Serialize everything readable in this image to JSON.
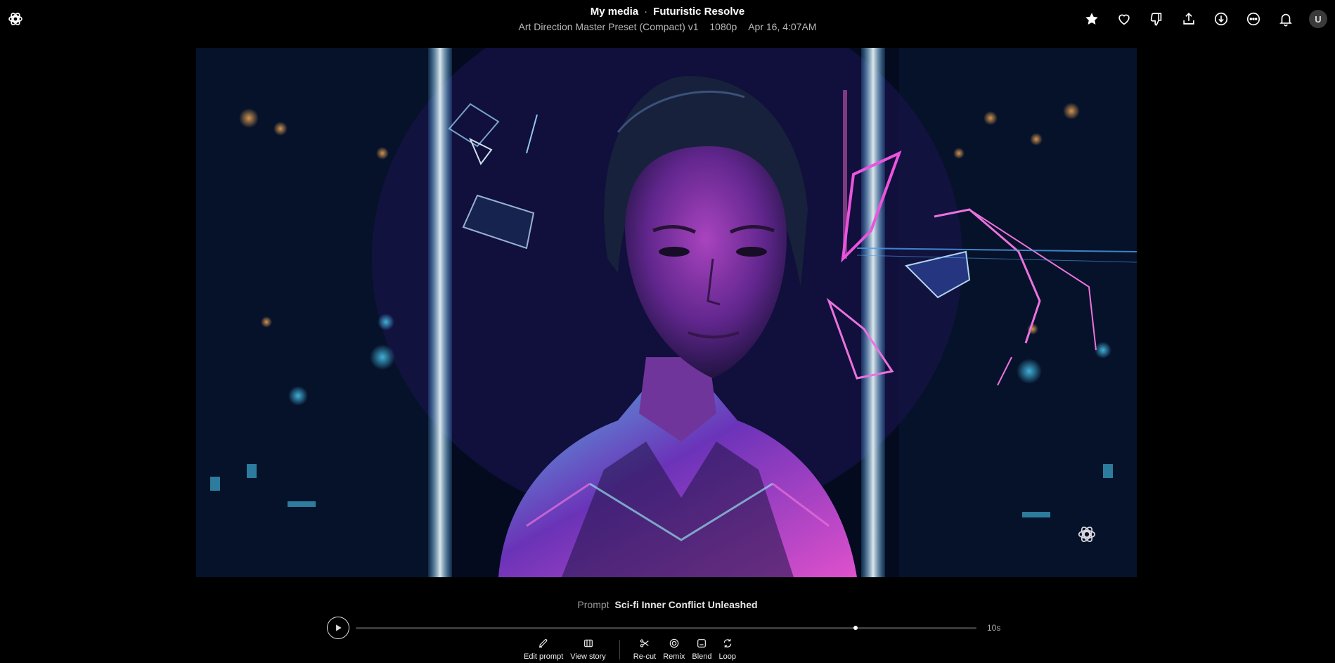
{
  "header": {
    "breadcrumb_parent": "My media",
    "separator": "·",
    "title": "Futuristic Resolve",
    "preset": "Art Direction Master Preset (Compact) v1",
    "resolution": "1080p",
    "timestamp": "Apr 16, 4:07AM",
    "avatar_initial": "U",
    "icons": [
      "openai-logo-icon",
      "star-icon",
      "heart-icon",
      "thumbs-down-icon",
      "share-icon",
      "download-icon",
      "more-icon",
      "bell-icon"
    ]
  },
  "media": {
    "watermark_icon": "openai-logo-icon"
  },
  "prompt": {
    "label": "Prompt",
    "text": "Sci-fi Inner Conflict Unleashed"
  },
  "player": {
    "progress": 0.805,
    "duration": "10s"
  },
  "actions": {
    "edit_prompt": "Edit prompt",
    "view_story": "View story",
    "recut": "Re-cut",
    "remix": "Remix",
    "blend": "Blend",
    "loop": "Loop"
  },
  "colors": {
    "background": "#000000",
    "neon_magenta": "#ff4df0",
    "neon_cyan": "#7fe8ff"
  }
}
